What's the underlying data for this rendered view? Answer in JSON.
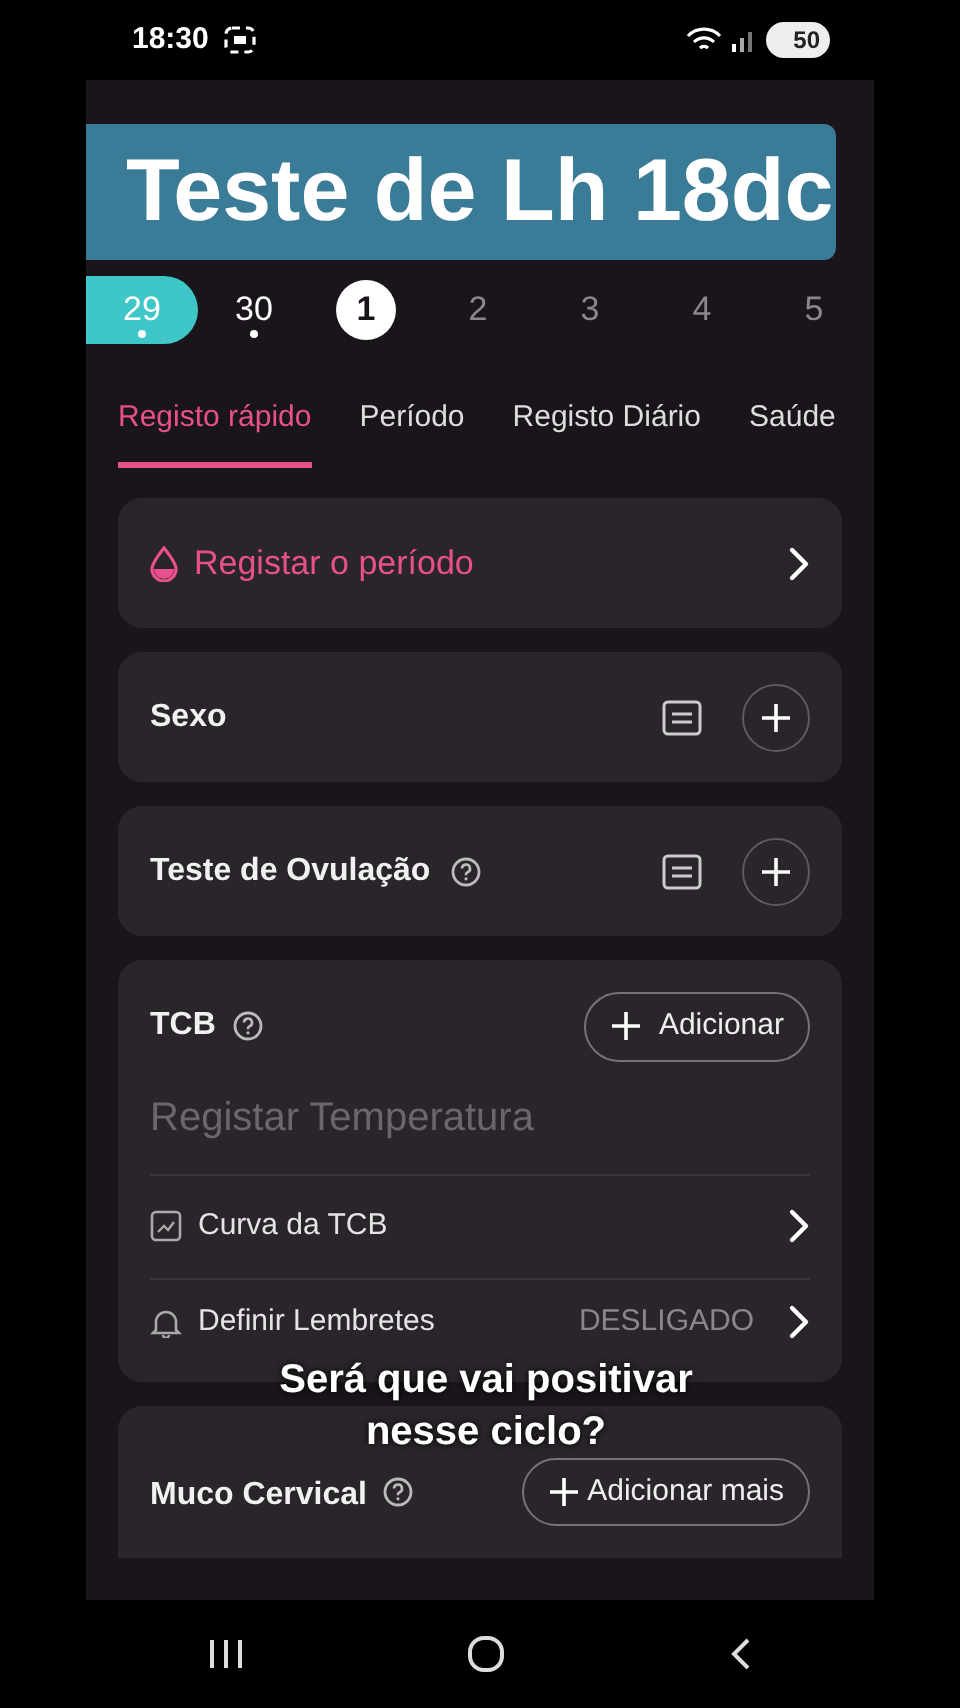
{
  "status_bar": {
    "time": "18:30",
    "battery": "50"
  },
  "captions": [
    "Teste de Lh 18dc",
    "Será  que vai positivar nesse ciclo?"
  ],
  "days": [
    {
      "label": "29",
      "kind": "highlight",
      "dot": true
    },
    {
      "label": "30",
      "kind": "past",
      "dot": true
    },
    {
      "label": "1",
      "kind": "today",
      "dot": false
    },
    {
      "label": "2",
      "kind": "future",
      "dot": false
    },
    {
      "label": "3",
      "kind": "future",
      "dot": false
    },
    {
      "label": "4",
      "kind": "future",
      "dot": false
    },
    {
      "label": "5",
      "kind": "future",
      "dot": false
    }
  ],
  "tabs": [
    {
      "label": "Registo rápido",
      "selected": true
    },
    {
      "label": "Período",
      "selected": false
    },
    {
      "label": "Registo Diário",
      "selected": false
    },
    {
      "label": "Saúde",
      "selected": false
    }
  ],
  "cards": [
    {
      "kind": "period",
      "label": "Registar o período"
    },
    {
      "kind": "entry",
      "label": "Sexo",
      "help": false
    },
    {
      "kind": "entry",
      "label": "Teste de Ovulação",
      "help": true
    },
    {
      "kind": "tcb",
      "title": "TCB",
      "button": "Adicionar",
      "placeholder": "Registar Temperatura",
      "rows": [
        {
          "kind": "chart",
          "label": "Curva da TCB"
        },
        {
          "kind": "reminder",
          "label": "Definir Lembretes",
          "value": "DESLIGADO"
        }
      ]
    },
    {
      "kind": "mucus",
      "title": "Muco Cervical",
      "button": "Adicionar mais"
    }
  ]
}
